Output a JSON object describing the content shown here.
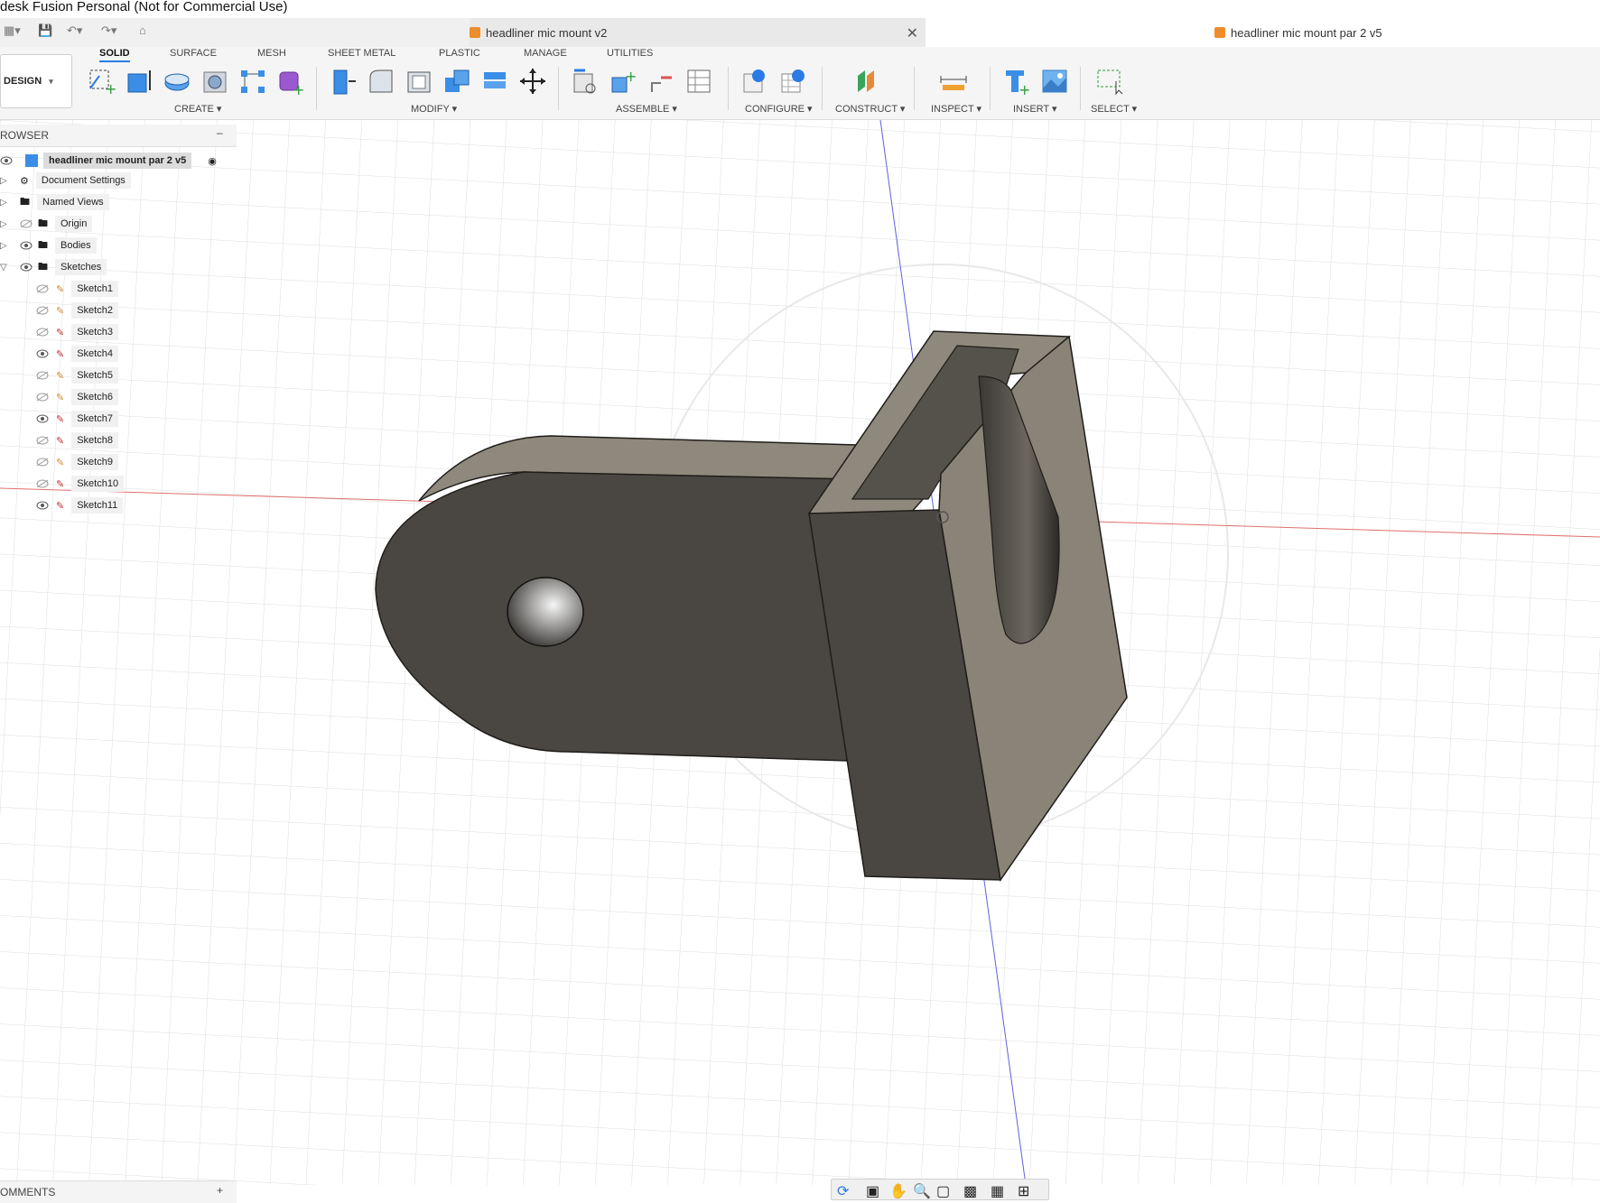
{
  "window": {
    "title": "desk Fusion Personal (Not for Commercial Use)"
  },
  "doc_tabs": [
    {
      "label": "headliner mic mount v2"
    },
    {
      "label": "headliner mic mount par 2 v5"
    }
  ],
  "toolbar": {
    "workspace": "DESIGN",
    "tabs": [
      "SOLID",
      "SURFACE",
      "MESH",
      "SHEET METAL",
      "PLASTIC",
      "MANAGE",
      "UTILITIES"
    ],
    "groups": [
      "CREATE",
      "MODIFY",
      "ASSEMBLE",
      "CONFIGURE",
      "CONSTRUCT",
      "INSPECT",
      "INSERT",
      "SELECT"
    ]
  },
  "browser": {
    "header": "ROWSER",
    "root": "headliner mic mount par 2 v5",
    "items": [
      "Document Settings",
      "Named Views",
      "Origin",
      "Bodies",
      "Sketches"
    ],
    "sketches": [
      "Sketch1",
      "Sketch2",
      "Sketch3",
      "Sketch4",
      "Sketch5",
      "Sketch6",
      "Sketch7",
      "Sketch8",
      "Sketch9",
      "Sketch10",
      "Sketch11"
    ]
  },
  "comments": {
    "label": "OMMENTS"
  },
  "colors": {
    "accent": "#2c7be5",
    "body_dark": "#4a4641",
    "body_light": "#8a8377",
    "axis_x": "#e05050",
    "axis_z": "#3d3dd8",
    "grid": "#dcdcdc"
  }
}
